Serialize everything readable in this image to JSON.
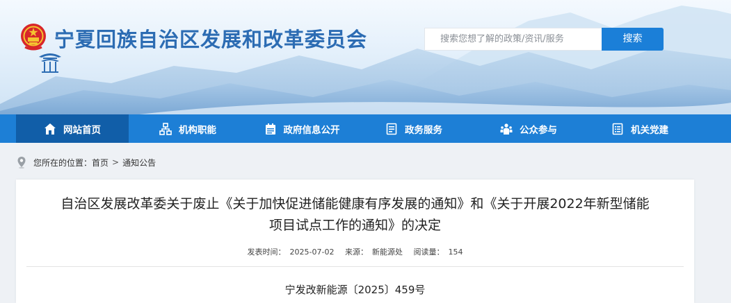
{
  "header": {
    "site_title": "宁夏回族自治区发展和改革委员会",
    "search_placeholder": "搜索您想了解的政策/资讯/服务",
    "search_button": "搜索"
  },
  "nav": {
    "items": [
      {
        "label": "网站首页",
        "icon": "home-icon",
        "active": true
      },
      {
        "label": "机构职能",
        "icon": "org-chart-icon",
        "active": false
      },
      {
        "label": "政府信息公开",
        "icon": "calendar-list-icon",
        "active": false
      },
      {
        "label": "政务服务",
        "icon": "document-icon",
        "active": false
      },
      {
        "label": "公众参与",
        "icon": "people-icon",
        "active": false
      },
      {
        "label": "机关党建",
        "icon": "document-list-icon",
        "active": false
      }
    ]
  },
  "breadcrumb": {
    "prefix": "您所在的位置：",
    "items": [
      "首页",
      "通知公告"
    ],
    "separator": ">"
  },
  "article": {
    "title_line1": "自治区发展改革委关于废止《关于加快促进储能健康有序发展的通知》和《关于开展2022年新型储能",
    "title_line2": "项目试点工作的通知》的决定",
    "publish_label": "发表时间：",
    "publish_date": "2025-07-02",
    "source_label": "来源：",
    "source": "新能源处",
    "views_label": "阅读量：",
    "views": "154",
    "doc_number": "宁发改新能源〔2025〕459号"
  },
  "colors": {
    "nav_bg": "#1d7fd6",
    "nav_active": "#115ea8",
    "title_blue": "#2c6cb3",
    "search_button": "#1b7fd8"
  }
}
